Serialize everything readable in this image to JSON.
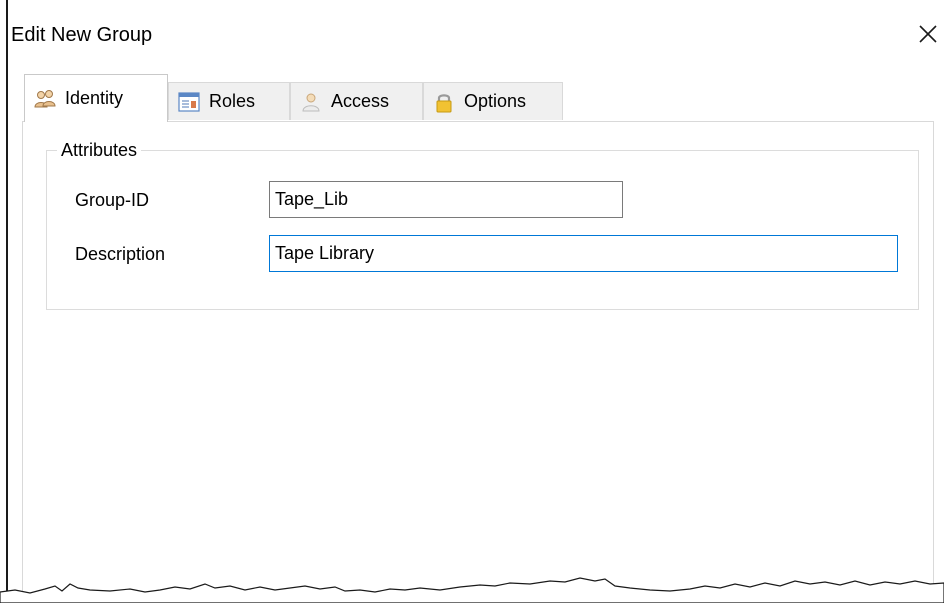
{
  "window": {
    "title": "Edit New Group"
  },
  "tabs": [
    {
      "label": "Identity",
      "icon": "users-icon",
      "selected": true
    },
    {
      "label": "Roles",
      "icon": "roles-icon",
      "selected": false
    },
    {
      "label": "Access",
      "icon": "person-icon",
      "selected": false
    },
    {
      "label": "Options",
      "icon": "lock-icon",
      "selected": false
    }
  ],
  "attributes": {
    "legend": "Attributes",
    "group_id": {
      "label": "Group-ID",
      "value": "Tape_Lib"
    },
    "description": {
      "label": "Description",
      "value": "Tape Library"
    }
  },
  "colors": {
    "focus_border": "#0078d7",
    "tab_inactive_bg": "#f0f0f0",
    "border": "#d9d9d9"
  }
}
